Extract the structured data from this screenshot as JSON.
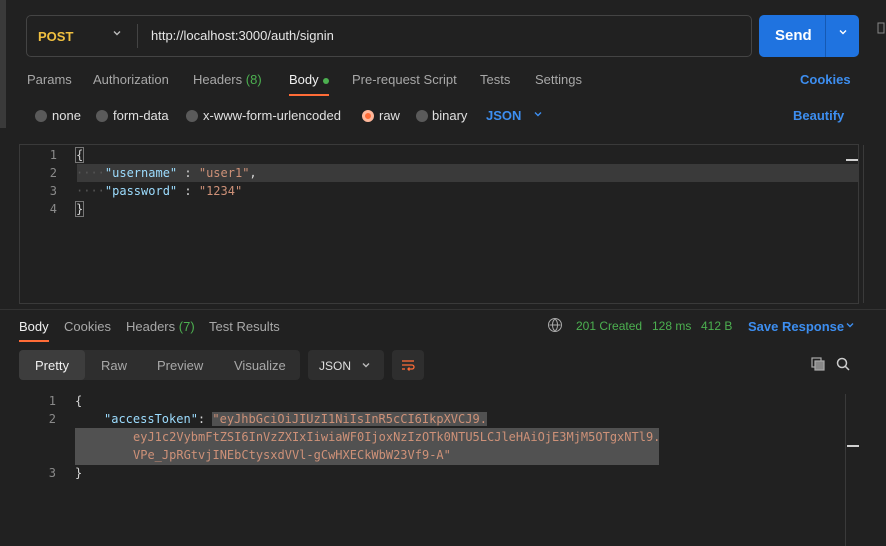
{
  "request": {
    "method": "POST",
    "url": "http://localhost:3000/auth/signin",
    "send_label": "Send"
  },
  "request_tabs": {
    "params": "Params",
    "authorization": "Authorization",
    "headers_label": "Headers",
    "headers_count": "(8)",
    "body": "Body",
    "pre_request": "Pre-request Script",
    "tests": "Tests",
    "settings": "Settings",
    "cookies": "Cookies"
  },
  "body_types": {
    "none": "none",
    "form_data": "form-data",
    "urlencoded": "x-www-form-urlencoded",
    "raw": "raw",
    "binary": "binary",
    "language": "JSON",
    "beautify": "Beautify",
    "selected": "raw"
  },
  "request_editor": {
    "line_numbers": [
      "1",
      "2",
      "3",
      "4"
    ],
    "open_brace": "{",
    "username_key": "\"username\"",
    "username_sep": " : ",
    "username_value": "\"user1\"",
    "username_comma": ",",
    "password_key": "\"password\"",
    "password_sep": " : ",
    "password_value": "\"1234\"",
    "close_brace": "}"
  },
  "response_tabs": {
    "body": "Body",
    "cookies": "Cookies",
    "headers_label": "Headers",
    "headers_count": "(7)",
    "test_results": "Test Results",
    "status": "201 Created",
    "time": "128 ms",
    "size": "412 B",
    "save_response": "Save Response"
  },
  "response_format": {
    "pretty": "Pretty",
    "raw": "Raw",
    "preview": "Preview",
    "visualize": "Visualize",
    "language": "JSON"
  },
  "response_body": {
    "line_numbers": [
      "1",
      "2",
      "3"
    ],
    "open_brace": "{",
    "key": "\"accessToken\"",
    "colon": ": ",
    "token_line1": "eyJhbGciOiJIUzI1NiIsInR5cCI6IkpXVCJ9.",
    "token_line2": "eyJ1c2VybmFtZSI6InVzZXIxIiwiaWF0IjoxNzIzOTk0NTU5LCJleHAiOjE3MjM5OTgxNTl9.",
    "token_line3": "VPe_JpRGtvjINEbCtysxdVVl-gCwHXECkWbW23Vf9-A",
    "close_brace": "}"
  },
  "colors": {
    "accent": "#ff6c37",
    "link": "#3d8ef0",
    "send": "#1f73e0",
    "success": "#4cb050",
    "method": "#f0c040"
  }
}
